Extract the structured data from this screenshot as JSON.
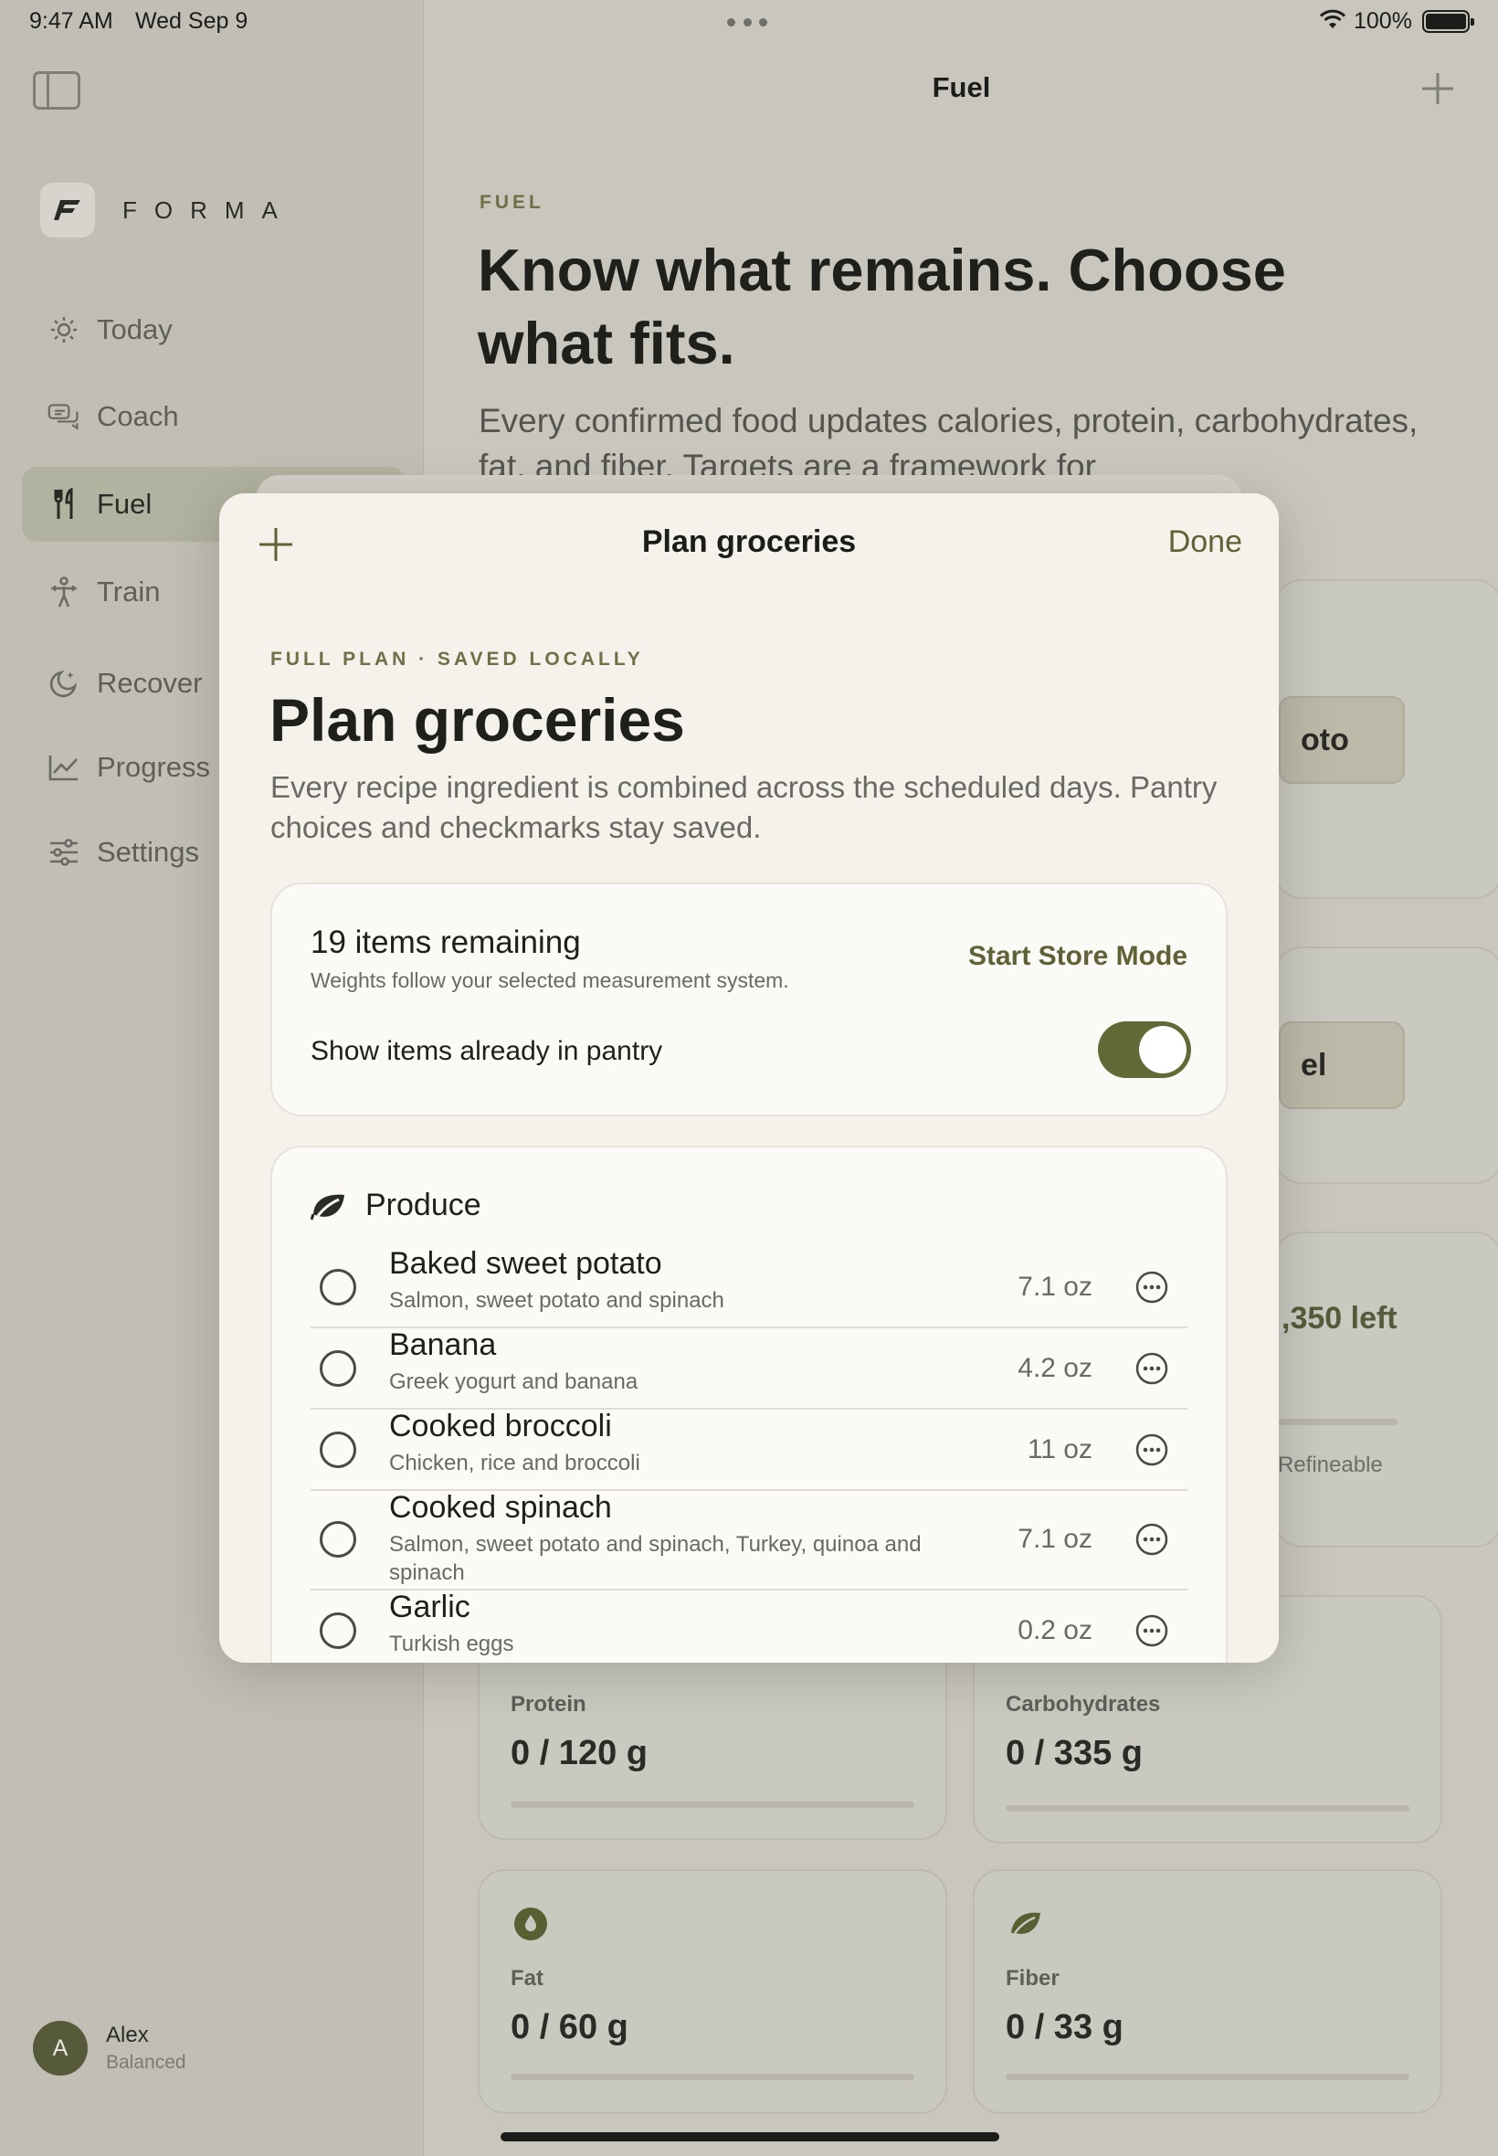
{
  "status": {
    "time": "9:47 AM",
    "date": "Wed Sep 9",
    "battery_pct": "100%"
  },
  "sidebar": {
    "brand": "FORMA",
    "items": [
      {
        "label": "Today",
        "icon": "sun-icon",
        "active": false
      },
      {
        "label": "Coach",
        "icon": "chat-bubbles-icon",
        "active": false
      },
      {
        "label": "Fuel",
        "icon": "fork-knife-icon",
        "active": true
      },
      {
        "label": "Train",
        "icon": "figure-strength-icon",
        "active": false
      },
      {
        "label": "Recover",
        "icon": "moon-icon",
        "active": false
      },
      {
        "label": "Progress",
        "icon": "chart-line-icon",
        "active": false
      },
      {
        "label": "Settings",
        "icon": "sliders-icon",
        "active": false
      }
    ],
    "user": {
      "initial": "A",
      "name": "Alex",
      "mode": "Balanced"
    }
  },
  "main": {
    "nav_title": "Fuel",
    "eyebrow": "FUEL",
    "hero": "Know what remains. Choose what fits.",
    "hero_sub": "Every confirmed food updates calories, protein, carbohydrates, fat, and fiber. Targets are a framework for",
    "peek_pill_1": "oto",
    "peek_pill_2": "el",
    "peek_left": ",350 left",
    "peek_refineable": "Refineable",
    "macros": [
      {
        "label": "Protein",
        "value": "0 / 120 g"
      },
      {
        "label": "Carbohydrates",
        "value": "0 / 335 g"
      },
      {
        "label": "Fat",
        "value": "0 / 60 g",
        "icon": "drop-icon"
      },
      {
        "label": "Fiber",
        "value": "0 / 33 g",
        "icon": "leaf-icon"
      }
    ]
  },
  "sheet": {
    "title": "Plan groceries",
    "done_label": "Done",
    "eyebrow": "FULL PLAN · SAVED LOCALLY",
    "heading": "Plan groceries",
    "description": "Every recipe ingredient is combined across the scheduled days. Pantry choices and checkmarks stay saved.",
    "summary": {
      "count": "19 items remaining",
      "hint": "Weights follow your selected measurement system.",
      "store_mode": "Start Store Mode",
      "pantry_label": "Show items already in pantry",
      "pantry_on": true
    },
    "section": {
      "title": "Produce",
      "icon": "leaf-icon",
      "items": [
        {
          "name": "Baked sweet potato",
          "source": "Salmon, sweet potato and spinach",
          "qty": "7.1 oz",
          "checked": false
        },
        {
          "name": "Banana",
          "source": "Greek yogurt and banana",
          "qty": "4.2 oz",
          "checked": false
        },
        {
          "name": "Cooked broccoli",
          "source": "Chicken, rice and broccoli",
          "qty": "11 oz",
          "checked": false
        },
        {
          "name": "Cooked spinach",
          "source": "Salmon, sweet potato and spinach, Turkey, quinoa and spinach",
          "qty": "7.1 oz",
          "checked": false
        },
        {
          "name": "Garlic",
          "source": "Turkish eggs",
          "qty": "0.2 oz",
          "checked": false
        }
      ]
    }
  },
  "colors": {
    "accent": "#5f6136",
    "toggle_on": "#626836",
    "avatar": "#575a3a"
  }
}
